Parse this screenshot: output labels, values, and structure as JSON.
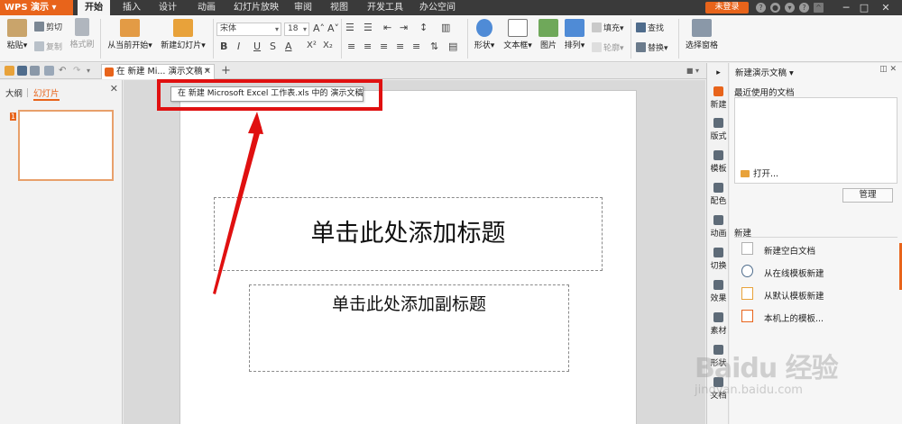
{
  "menu": {
    "app_name": "WPS 演示",
    "tabs": [
      "开始",
      "插入",
      "设计",
      "动画",
      "幻灯片放映",
      "审阅",
      "视图",
      "开发工具",
      "办公空间"
    ],
    "active_tab": "开始",
    "login": "未登录",
    "window_controls": [
      "─",
      "□",
      "✕"
    ]
  },
  "ribbon": {
    "paste": "粘贴",
    "cut": "剪切",
    "copy": "复制",
    "format_painter": "格式刷",
    "from_current": "从当前开始",
    "new_slide": "新建幻灯片",
    "font_name": "宋体",
    "font_size": "18",
    "shape": "形状",
    "textbox": "文本框",
    "picture": "图片",
    "arrange": "排列",
    "fill": "填充",
    "outline": "轮廓",
    "find": "查找",
    "replace": "替换",
    "select_pane": "选择窗格"
  },
  "tabstrip": {
    "doc_tab": "在 新建 Mi... 演示文稿 *",
    "close": "✕",
    "add": "+"
  },
  "tooltip": "在 新建 Microsoft Excel 工作表.xls 中的 演示文稿",
  "left_panel": {
    "tab_outline": "大纲",
    "tab_slides": "幻灯片",
    "slide_number": "1",
    "close": "✕"
  },
  "slide": {
    "title_placeholder": "单击此处添加标题",
    "subtitle_placeholder": "单击此处添加副标题"
  },
  "right_strip": [
    "新建",
    "版式",
    "模板",
    "配色",
    "动画",
    "切换",
    "效果",
    "素材",
    "形状",
    "文档"
  ],
  "task_pane": {
    "title": "新建演示文稿 ▾",
    "recent_label": "最近使用的文档",
    "open": "打开...",
    "manage": "管理",
    "new_label": "新建",
    "links": [
      "新建空白文档",
      "从在线模板新建",
      "从默认模板新建",
      "本机上的模板..."
    ]
  },
  "watermark": {
    "text": "Baidu 经验",
    "url": "jingyan.baidu.com"
  },
  "colors": {
    "accent": "#e8641b",
    "annotation_red": "#e01010",
    "titlebar": "#3a3a3a"
  }
}
